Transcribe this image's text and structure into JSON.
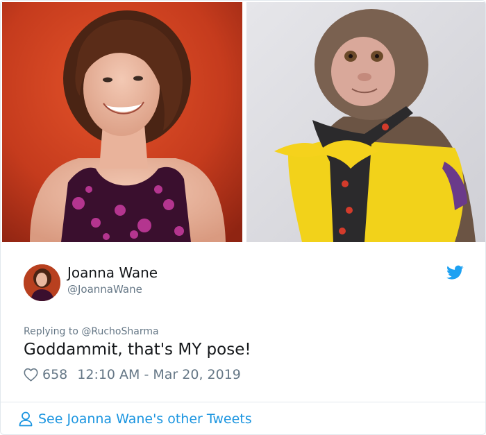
{
  "photos": {
    "left_description_icon": "woman-portrait-image",
    "right_description_icon": "monkey-portrait-image"
  },
  "tweet": {
    "author_name": "Joanna Wane",
    "author_handle": "@JoannaWane",
    "replying_prefix": "Replying to",
    "replying_handle": "@RuchoSharma",
    "text": "Goddammit, that's MY pose!",
    "likes": "658",
    "timestamp": "12:10 AM - Mar 20, 2019",
    "brand_icon": "twitter-bird-icon",
    "like_icon": "heart-icon"
  },
  "footer": {
    "link_label": "See Joanna Wane's other Tweets",
    "icon": "user-icon"
  },
  "colors": {
    "link": "#1b95e0",
    "muted": "#657786",
    "text": "#14171a",
    "brand": "#1da1f2"
  }
}
